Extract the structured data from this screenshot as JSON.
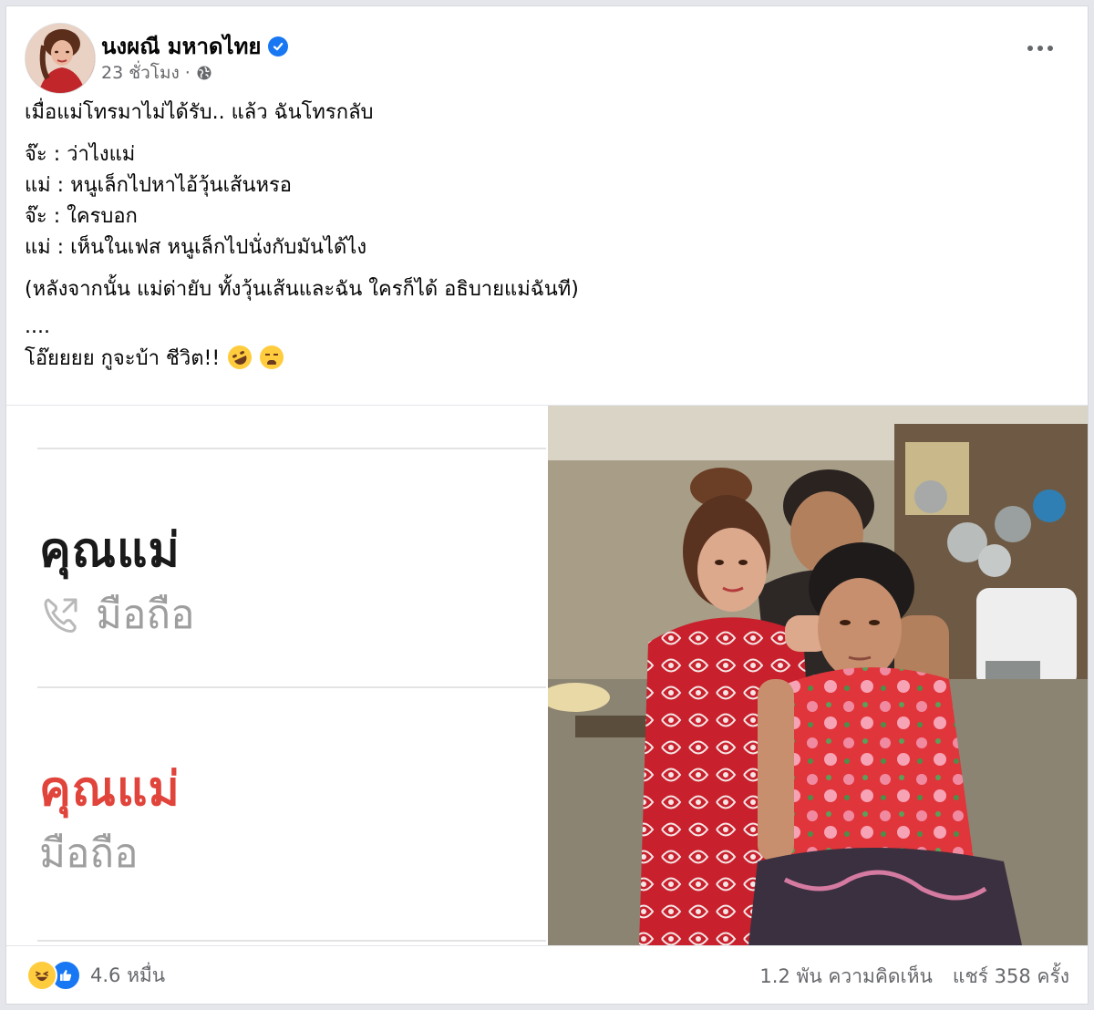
{
  "post": {
    "author": {
      "name": "นงผณี มหาดไทย",
      "verified": true
    },
    "meta": {
      "time": "23 ชั่วโมง",
      "separator": "·",
      "audience_icon": "globe-icon"
    },
    "text": {
      "intro": "เมื่อแม่โทรมาไม่ได้รับ.. แล้ว ฉันโทรกลับ",
      "dialogue": [
        "จ๊ะ : ว่าไงแม่",
        "แม่ : หนูเล็กไปหาไอ้วุ้นเส้นหรอ",
        "จ๊ะ : ใครบอก",
        "แม่ : เห็นในเฟส หนูเล็กไปนั่งกับมันได้ไง"
      ],
      "aside": "(หลังจากนั้น แม่ด่ายับ ทั้งวุ้นเส้นและฉัน ใครก็ได้ อธิบายแม่ฉันที)",
      "ellipsis": "....",
      "closing": "โอ๊ยยยย กูจะบ้า ชีวิต!!",
      "closing_emojis": [
        "rofl-emoji",
        "tired-face-emoji"
      ]
    },
    "media": {
      "call_log": {
        "outgoing": {
          "name": "คุณแม่",
          "type": "มือถือ",
          "icon": "outgoing-call-icon"
        },
        "missed": {
          "name": "คุณแม่",
          "type": "มือถือ",
          "color": "#e0443b"
        }
      },
      "photo_description": "photo"
    },
    "footer": {
      "reactions": [
        "haha-icon",
        "like-icon"
      ],
      "reaction_count": "4.6 หมื่น",
      "comments": "1.2 พัน ความคิดเห็น",
      "shares": "แชร์ 358 ครั้ง"
    }
  },
  "colors": {
    "accent": "#1877f2",
    "secondary_text": "#65676b",
    "missed_call": "#e0443b"
  }
}
